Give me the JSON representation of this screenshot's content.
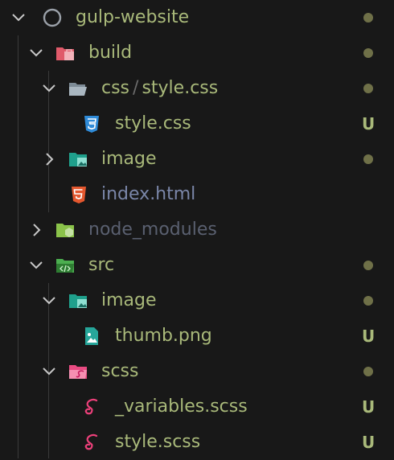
{
  "tree": {
    "root": {
      "label": "gulp-website"
    },
    "build": {
      "label": "build"
    },
    "css_folder": {
      "label": "css",
      "separator": "/",
      "sublabel": "style.css"
    },
    "css_file": {
      "label": "style.css",
      "badge": "U"
    },
    "build_image": {
      "label": "image"
    },
    "index_html": {
      "label": "index.html"
    },
    "node_modules": {
      "label": "node_modules"
    },
    "src": {
      "label": "src"
    },
    "src_image": {
      "label": "image"
    },
    "thumb": {
      "label": "thumb.png",
      "badge": "U"
    },
    "scss": {
      "label": "scss"
    },
    "variables": {
      "label": "_variables.scss",
      "badge": "U"
    },
    "style_scss": {
      "label": "style.scss",
      "badge": "U"
    }
  },
  "colors": {
    "background": "#181818",
    "label_modified": "#a9b97a",
    "label_ignored": "#5a6070",
    "dot": "#6f7048"
  },
  "icons": {
    "root": "circle-outline-icon",
    "build": "folder-open-red-icon",
    "css": "folder-open-gray-icon",
    "css_file": "css3-icon",
    "image": "folder-image-icon",
    "html": "html5-icon",
    "node": "folder-node-icon",
    "src": "folder-src-icon",
    "png": "image-file-icon",
    "scss_folder": "folder-sass-icon",
    "scss_file": "sass-icon"
  }
}
